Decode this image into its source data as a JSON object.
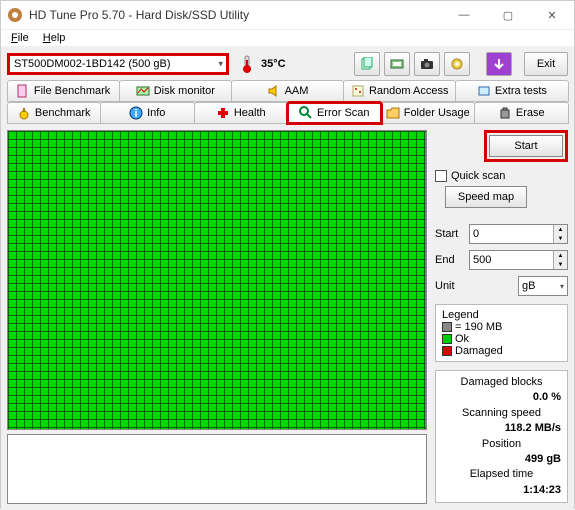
{
  "window": {
    "title": "HD Tune Pro 5.70 - Hard Disk/SSD Utility"
  },
  "menu": {
    "file": "File",
    "help": "Help"
  },
  "device": {
    "selected": "ST500DM002-1BD142 (500 gB)"
  },
  "temp": {
    "value": "35°C"
  },
  "toolbar": {
    "exit": "Exit"
  },
  "tabs": {
    "row1": [
      "File Benchmark",
      "Disk monitor",
      "AAM",
      "Random Access",
      "Extra tests"
    ],
    "row2": [
      "Benchmark",
      "Info",
      "Health",
      "Error Scan",
      "Folder Usage",
      "Erase"
    ],
    "active": "Error Scan"
  },
  "sidebar": {
    "start": "Start",
    "quick_scan": "Quick scan",
    "speed_map": "Speed map",
    "start_label": "Start",
    "start_value": "0",
    "end_label": "End",
    "end_value": "500",
    "unit_label": "Unit",
    "unit_value": "gB"
  },
  "legend": {
    "title": "Legend",
    "block_size": "= 190 MB",
    "ok": "Ok",
    "damaged": "Damaged"
  },
  "stats": {
    "damaged_blocks_label": "Damaged blocks",
    "damaged_blocks": "0.0 %",
    "scanning_speed_label": "Scanning speed",
    "scanning_speed": "118.2 MB/s",
    "position_label": "Position",
    "position": "499 gB",
    "elapsed_label": "Elapsed time",
    "elapsed": "1:14:23"
  }
}
